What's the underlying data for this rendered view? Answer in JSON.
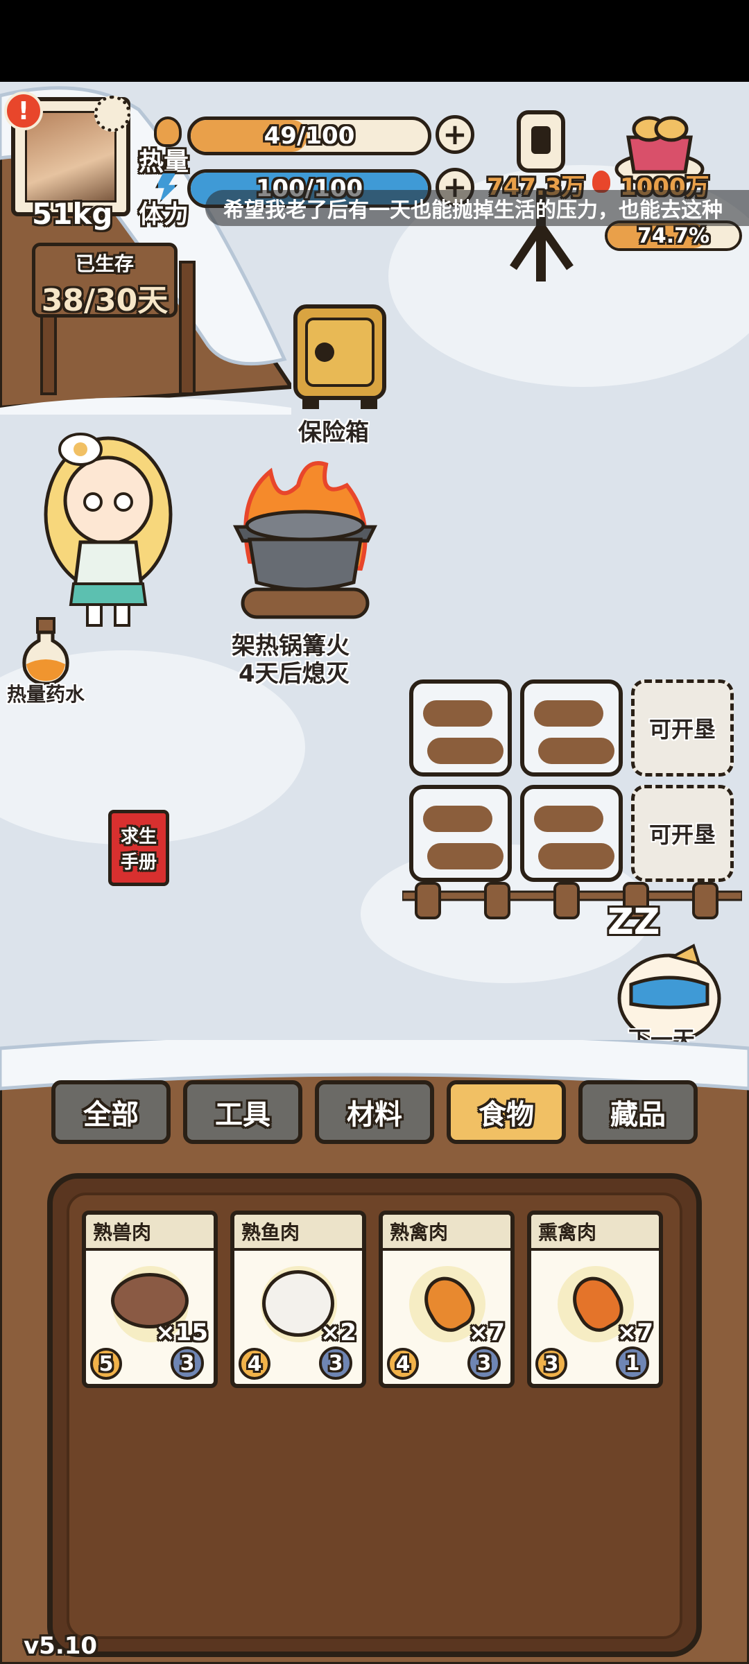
{
  "status": {
    "avatar_alert": "!",
    "weight": "51kg",
    "heat_label": "热量",
    "heat_value": "49/100",
    "heat_fraction": 0.49,
    "stamina_label": "体力",
    "stamina_value": "100/100",
    "stamina_fraction": 1.0,
    "plus_symbol": "+"
  },
  "survival": {
    "label": "已生存",
    "days": "38/30天"
  },
  "live": {
    "viewers": "747.3万",
    "goal": "1000万",
    "progress_text": "74.7%",
    "progress_fraction": 0.747
  },
  "danmaku": "希望我老了后有一天也能抛掉生活的压力，也能去这种",
  "scene": {
    "safe_label": "保险箱",
    "fire_label": "架热锅篝火",
    "fire_timer": "4天后熄灭",
    "potion_label": "热量药水",
    "manual_line1": "求生",
    "manual_line2": "手册",
    "farm_empty_label": "可开垦",
    "next_day_label": "下一天",
    "sleep_text": "ZZ"
  },
  "tabs": [
    {
      "label": "全部",
      "active": false
    },
    {
      "label": "工具",
      "active": false
    },
    {
      "label": "材料",
      "active": false
    },
    {
      "label": "食物",
      "active": true
    },
    {
      "label": "藏品",
      "active": false
    }
  ],
  "inventory": [
    {
      "name": "熟兽肉",
      "count": "×15",
      "heat": "5",
      "cost": "3",
      "icon": "cooked-beast-meat-icon"
    },
    {
      "name": "熟鱼肉",
      "count": "×2",
      "heat": "4",
      "cost": "3",
      "icon": "cooked-fish-icon"
    },
    {
      "name": "熟禽肉",
      "count": "×7",
      "heat": "4",
      "cost": "3",
      "icon": "cooked-poultry-icon"
    },
    {
      "name": "熏禽肉",
      "count": "×7",
      "heat": "3",
      "cost": "1",
      "icon": "smoked-poultry-icon"
    }
  ],
  "version": "v5.10",
  "colors": {
    "heat_bar": "#e9a04a",
    "stamina_bar": "#3f9ad6",
    "progress_bar": "#e9a04a",
    "active_tab": "#f1c064",
    "inactive_tab": "#6b6a66",
    "panel_wood": "#6e4428"
  }
}
